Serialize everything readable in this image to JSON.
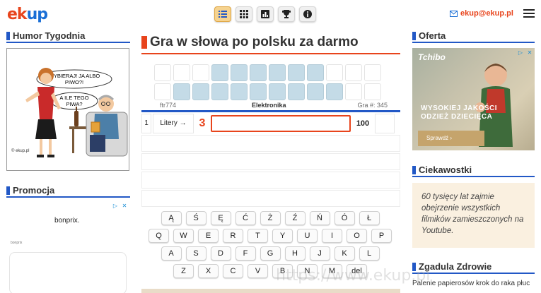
{
  "header": {
    "logo": [
      "e",
      "k",
      "u",
      "p"
    ],
    "email": "ekup@ekup.pl",
    "toolbar": [
      "list-icon",
      "grid-icon",
      "stats-icon",
      "trophy-icon",
      "info-icon"
    ]
  },
  "left": {
    "humor_title": "Humor Tygodnia",
    "comic": {
      "bubble1": [
        "WYBIERAJ! JA ALBO",
        "PIWO?!"
      ],
      "bubble2": [
        "A ILE TEGO",
        "PIWA?"
      ],
      "credit": "© ekup.pl"
    },
    "promo_title": "Promocja",
    "ad_brand": "bonprix.",
    "ad_small": "bonprix"
  },
  "game": {
    "title": "Gra w słowa po polsku za darmo",
    "code": "ftr774",
    "category": "Elektronika",
    "game_number": "Gra #: 345",
    "row_number": "1",
    "letters_button": "Litery →",
    "letter_count": "3",
    "input_value": "",
    "score": "100",
    "keyboard": [
      [
        "Ą",
        "Ś",
        "Ę",
        "Ć",
        "Ż",
        "Ź",
        "Ń",
        "Ó",
        "Ł"
      ],
      [
        "Q",
        "W",
        "E",
        "R",
        "T",
        "Y",
        "U",
        "I",
        "O",
        "P"
      ],
      [
        "A",
        "S",
        "D",
        "F",
        "G",
        "H",
        "J",
        "K",
        "L"
      ],
      [
        "Z",
        "X",
        "C",
        "V",
        "B",
        "N",
        "M",
        "del"
      ]
    ]
  },
  "right": {
    "oferta_title": "Oferta",
    "ad": {
      "brand": "Tchibo",
      "line1": "WYSOKIEJ JAKOŚCI",
      "line2": "ODZIEŻ DZIECIĘCA",
      "cta": "Sprawdź  ›"
    },
    "ciekawostki_title": "Ciekawostki",
    "ciekawostki_text": "60 tysięcy lat zajmie obejrzenie wszystkich filmików zamieszczonych na Youtube.",
    "zgadula_title": "Zgadula Zdrowie",
    "zgadula_text": "Palenie papierosów krok do raka płuc"
  },
  "watermark": "https://www.ekup.pl"
}
